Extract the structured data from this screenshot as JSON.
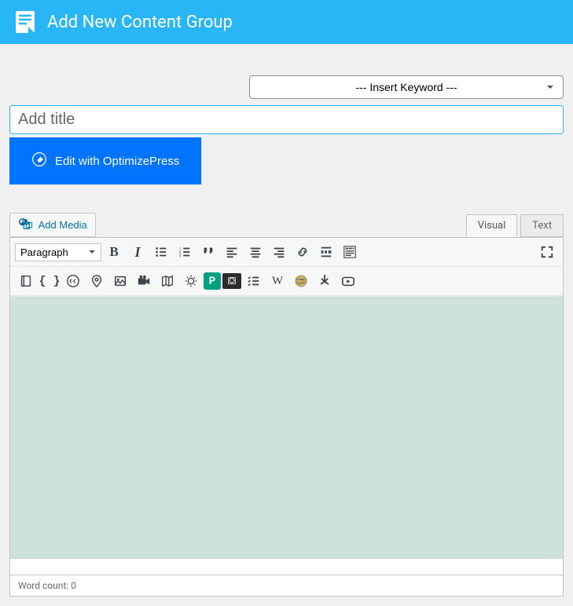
{
  "header": {
    "title": "Add New Content Group"
  },
  "keyword": {
    "placeholder": "--- Insert Keyword ---"
  },
  "title": {
    "placeholder": "Add title"
  },
  "optimizepress": {
    "label": "Edit with OptimizePress"
  },
  "media": {
    "label": "Add Media"
  },
  "tabs": {
    "visual": "Visual",
    "text": "Text"
  },
  "toolbar": {
    "format": "Paragraph"
  },
  "status": {
    "wordcount": "Word count: 0"
  }
}
